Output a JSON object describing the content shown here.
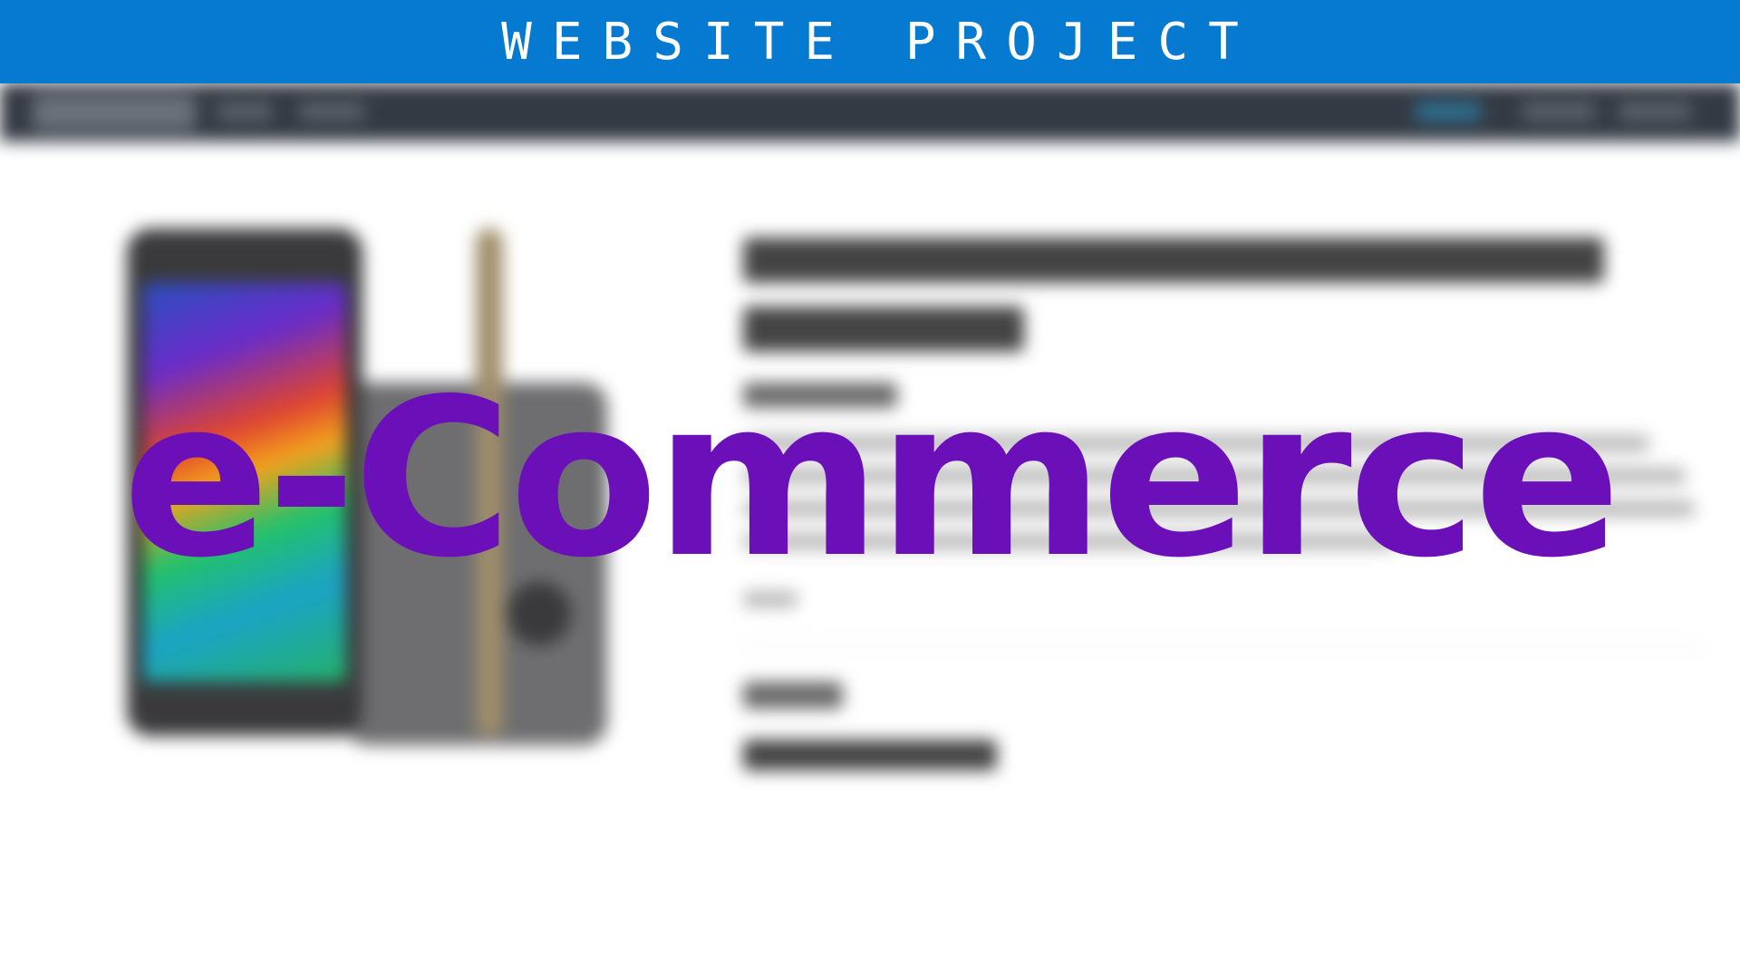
{
  "banner": {
    "title": "WEBSITE PROJECT",
    "background_color": "#057ad0",
    "text_color": "#ffffff"
  },
  "headline": {
    "text": "e-Commerce",
    "color": "#6b10b9"
  },
  "background_site": {
    "blurred": true,
    "navbar_color": "#343a44",
    "product_image": "smartphone-image"
  }
}
